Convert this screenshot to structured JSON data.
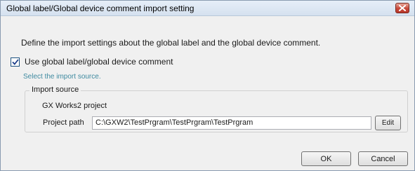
{
  "window": {
    "title": "Global label/Global device comment import setting",
    "close_icon": "close-icon",
    "close_color": "#c7483a"
  },
  "description": "Define the import settings about the global label and the global device comment.",
  "use_global": {
    "label": "Use global label/global device comment",
    "checked": true
  },
  "hint": "Select the import source.",
  "import_source": {
    "legend": "Import source",
    "source_name": "GX Works2 project",
    "path_label": "Project path",
    "path_value": "C:\\GXW2\\TestPrgram\\TestPrgram\\TestPrgram",
    "edit_label": "Edit"
  },
  "buttons": {
    "ok_label": "OK",
    "cancel_label": "Cancel"
  }
}
